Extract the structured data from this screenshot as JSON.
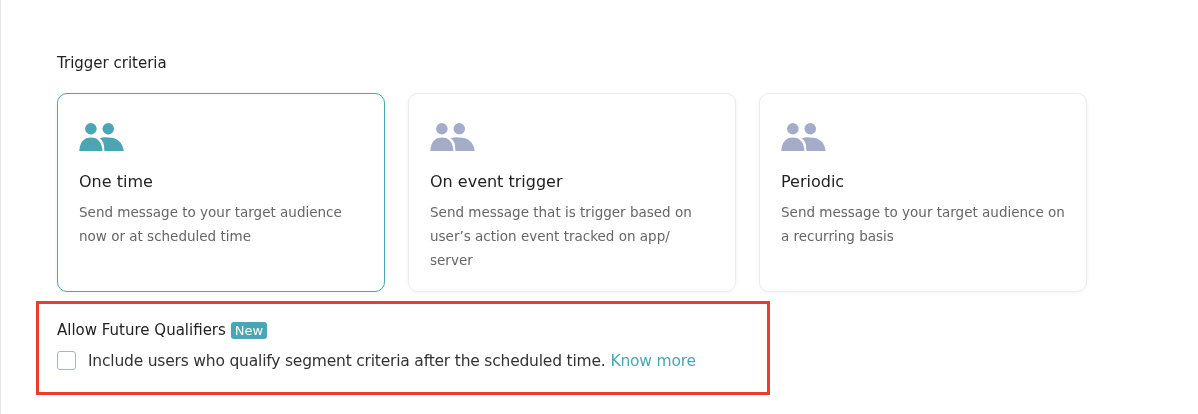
{
  "section_title": "Trigger criteria",
  "options": [
    {
      "title": "One time",
      "description": "Send message to your target audience now or at scheduled time",
      "selected": true
    },
    {
      "title": "On event trigger",
      "description": "Send message that is trigger based on user’s action event tracked on app/ server",
      "selected": false
    },
    {
      "title": "Periodic",
      "description": "Send message to your target audience on a recurring basis",
      "selected": false
    }
  ],
  "future_qualifiers": {
    "title": "Allow Future Qualifiers",
    "badge": "New",
    "checkbox_label": "Include users who qualify segment criteria after the scheduled time.",
    "link": "Know more",
    "checked": false,
    "highlighted": true
  }
}
